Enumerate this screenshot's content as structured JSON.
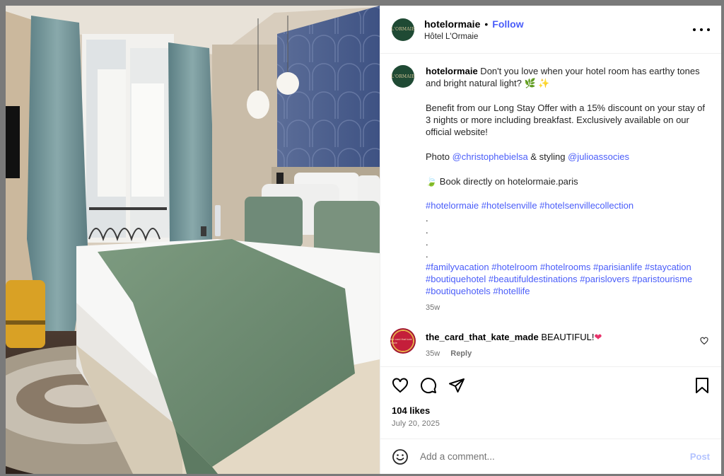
{
  "account": {
    "username": "hotelormaie",
    "separator": "•",
    "follow_label": "Follow",
    "location": "Hôtel L'Ormaie",
    "avatar_text": "L'ORMAIE"
  },
  "caption": {
    "username": "hotelormaie",
    "line1": " Don't you love when your hotel room has earthy tones and bright natural light? ",
    "emoji1": "🌿",
    "emoji2": "✨",
    "para2": "Benefit from our Long Stay Offer with a 15% discount on your stay of 3 nights or more including breakfast. Exclusively available on our official website!",
    "photo_prefix": "Photo ",
    "photo_credit": "@christophebielsa",
    "styling_prefix": " & styling ",
    "styling_credit": "@julioassocies",
    "book_emoji": "🍃",
    "book_text": " Book directly on hotelormaie.paris",
    "hashtags1": "#hotelormaie #hotelsenville #hotelsenvillecollection",
    "dots": [
      ".",
      ".",
      ".",
      "."
    ],
    "hashtags2": "#familyvacation #hotelroom #hotelrooms #parisianlife #staycation #boutiquehotel #beautifuldestinations #parislovers #paristourisme #boutiquehotels #hotellife",
    "age": "35w"
  },
  "comment": {
    "username": "the_card_that_kate_made",
    "text": " BEAUTIFUL!",
    "emoji": "❤",
    "age": "35w",
    "reply_label": "Reply",
    "avatar_text": "the card that kate made"
  },
  "post": {
    "likes": "104 likes",
    "date": "July 20, 2025"
  },
  "comment_box": {
    "placeholder": "Add a comment...",
    "post_label": "Post"
  },
  "icons": {
    "more": "more-options-icon",
    "like": "heart-icon",
    "comment": "comment-bubble-icon",
    "share": "paper-plane-icon",
    "save": "bookmark-icon",
    "emoji": "emoji-smiley-icon"
  },
  "colors": {
    "link": "#4a5df9",
    "post_disabled": "#b3c3ff",
    "muted": "#737373",
    "brand_green": "#1f4a34"
  }
}
